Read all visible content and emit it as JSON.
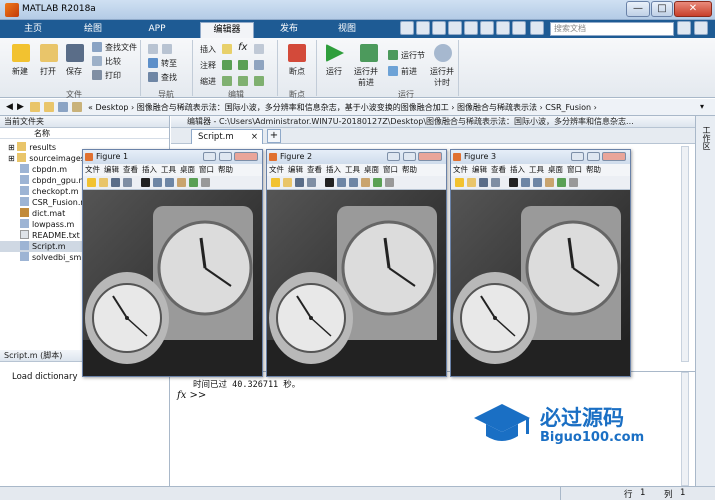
{
  "window": {
    "title": "MATLAB R2018a",
    "min": "—",
    "max": "□",
    "close": "✕"
  },
  "tabs": [
    "主页",
    "绘图",
    "APP",
    "编辑器",
    "发布",
    "视图"
  ],
  "search": {
    "placeholder": "搜索文档"
  },
  "ribbon": {
    "file": {
      "new": "新建",
      "open": "打开",
      "save": "保存",
      "find_file": "查找文件",
      "compare": "比较",
      "print": "打印",
      "group": "文件"
    },
    "nav": {
      "goto": "转至",
      "find": "查找",
      "group": "导航"
    },
    "edit": {
      "insert": "插入",
      "comment": "注释",
      "indent": "缩进",
      "group": "编辑"
    },
    "breakpoints": {
      "label": "断点",
      "group": "断点"
    },
    "run": {
      "run": "运行",
      "run_advance": "运行并\n前进",
      "run_section": "运行节",
      "advance": "前进",
      "run_time": "运行并\n计时",
      "group": "运行"
    }
  },
  "address": {
    "path": "« Desktop › 图像融合与稀疏表示法：国际小波，多分辨率和信息杂志，基于小波变换的图像融合加工 › 图像融合与稀疏表示法 › CSR_Fusion ›"
  },
  "current_folder": {
    "title": "当前文件夹",
    "col_name": "名称",
    "files": [
      "results",
      "sourceimages",
      "cbpdn.m",
      "cbpdn_gpu.m",
      "checkopt.m",
      "CSR_Fusion.m",
      "dict.mat",
      "lowpass.m",
      "README.txt",
      "Script.m",
      "solvedbi_sm.m"
    ],
    "selected": "Script.m"
  },
  "details": {
    "title": "Script.m  (脚本)",
    "text": "Load dictionary"
  },
  "editor": {
    "title": "编辑器 - C:\\Users\\Administrator.WIN7U-20180127Z\\Desktop\\图像融合与稀疏表示法：国际小波，多分辨率和信息杂志...",
    "tab": "Script.m",
    "add": "+"
  },
  "command": {
    "output": "时间已过 40.326711 秒。",
    "prompt": "fx >>"
  },
  "right_panel": "工作区",
  "figures": [
    {
      "title": "Figure 1"
    },
    {
      "title": "Figure 2"
    },
    {
      "title": "Figure 3"
    }
  ],
  "figure_menu": [
    "文件",
    "编辑",
    "查看",
    "插入",
    "工具",
    "桌面",
    "窗口",
    "帮助"
  ],
  "watermark": {
    "line1": "必过源码",
    "line2": "Biguo100.com"
  },
  "status": {
    "row_label": "行",
    "row": "1",
    "col_label": "列",
    "col": "1"
  },
  "colors": {
    "title_blue": "#1e5b94",
    "watermark_blue": "#1a6fc4"
  }
}
